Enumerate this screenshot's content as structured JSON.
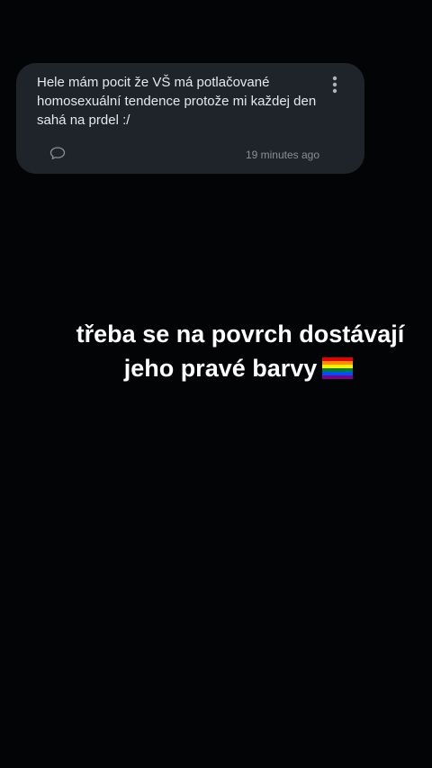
{
  "message": {
    "text": "Hele mám pocit že VŠ má potlačované homosexuální tendence protože mi každej den sahá na prdel :/",
    "timestamp": "19 minutes ago",
    "reply_icon": "speech-bubble-icon",
    "menu_icon": "more-vertical-icon"
  },
  "overlay": {
    "line1": "třeba se na povrch dostávají",
    "line2": "jeho pravé barvy",
    "emoji": "rainbow-flag-icon"
  },
  "colors": {
    "background": "#030405",
    "card": "#1f232a",
    "card_text": "#e6e8eb",
    "muted": "#8a8f96",
    "overlay_text": "#ffffff"
  }
}
